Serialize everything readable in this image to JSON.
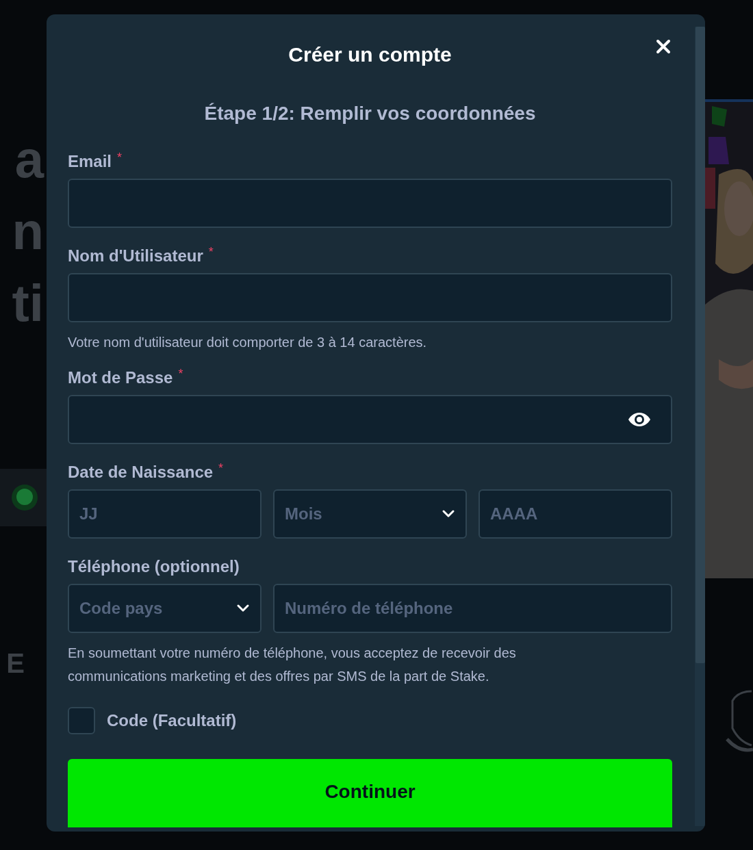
{
  "backdrop": {
    "headline_fragments": [
      "a",
      "n",
      "ti"
    ],
    "footer_fragment": "E"
  },
  "modal": {
    "title": "Créer un compte",
    "subtitle": "Étape 1/2: Remplir vos coordonnées",
    "fields": [
      {
        "kind": "text",
        "label": "Email",
        "marker": "*"
      },
      {
        "kind": "text",
        "label": "Nom d'Utilisateur",
        "marker": "*",
        "hint": "Votre nom d'utilisateur doit comporter de 3 à 14 caractères."
      },
      {
        "kind": "password",
        "label": "Mot de Passe",
        "marker": "*"
      },
      {
        "kind": "group",
        "label": "Date de Naissance",
        "marker": "*",
        "inputs": [
          {
            "kind": "text",
            "placeholder": "JJ"
          },
          {
            "kind": "select",
            "placeholder": "Mois"
          },
          {
            "kind": "text",
            "placeholder": "AAAA"
          }
        ]
      },
      {
        "kind": "group",
        "label": "Téléphone (optionnel)",
        "hint": "En soumettant votre numéro de téléphone, vous acceptez de recevoir des communications marketing et des offres par SMS de la part de Stake.",
        "inputs": [
          {
            "kind": "select",
            "placeholder": "Code pays"
          },
          {
            "kind": "tel",
            "placeholder": "Numéro de téléphone"
          }
        ]
      }
    ],
    "code_option": {
      "label": "Code (Facultatif)",
      "checked": false
    },
    "submit": "Continuer"
  }
}
